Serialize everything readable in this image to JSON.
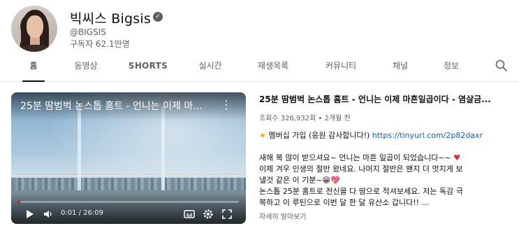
{
  "channel": {
    "name": "빅씨스 Bigsis",
    "verified_icon": "check-circle-icon",
    "handle": "@BIGSIS",
    "subscribers": "구독자 62.1만명"
  },
  "tabs": [
    {
      "label": "홈",
      "active": true
    },
    {
      "label": "동영상",
      "active": false
    },
    {
      "label": "SHORTS",
      "active": false
    },
    {
      "label": "실시간",
      "active": false
    },
    {
      "label": "재생목록",
      "active": false
    },
    {
      "label": "커뮤니티",
      "active": false
    },
    {
      "label": "채널",
      "active": false
    },
    {
      "label": "정보",
      "active": false
    }
  ],
  "search_icon": "search-icon",
  "player": {
    "title": "25분 땀범벅 논스톱 홈트 - 언니는 이제 마...",
    "time": "0:01 / 26:09",
    "progress_fraction": 0.001
  },
  "video": {
    "title": "25분 땀범벅 논스톱 홈트 - 언니는 이제 마흔일곱이다 - 염살금...",
    "meta": "조회수 326,932회 • 2개월 전"
  },
  "description": {
    "membership_prefix": "멤버십 가입 (응원 감사합니다!) ",
    "membership_link": "https://tinyurl.com/2p82daxr",
    "line1": "새해 복 많이 받으셔요~ 언니는 마흔 일곱이 되었습니다~~ ",
    "line2": "이제 겨우 인생의 절반 왔네요. 나머지 절반은 왠지 더 멋지게 보",
    "line3": "낼것 같은 이 기분~",
    "line4": "논스톱 25분 홈트로 전신을 다 땀으로 적셔보세요. 저는 독감 극",
    "line5": "복하고 이 루틴으로 이번 달 한 달 유산소 갑니다!! ..."
  },
  "read_more": "자세히 알아보기",
  "colors": {
    "accent_red": "#ff0000",
    "link_blue": "#065fd4",
    "muted_text": "#606060"
  }
}
